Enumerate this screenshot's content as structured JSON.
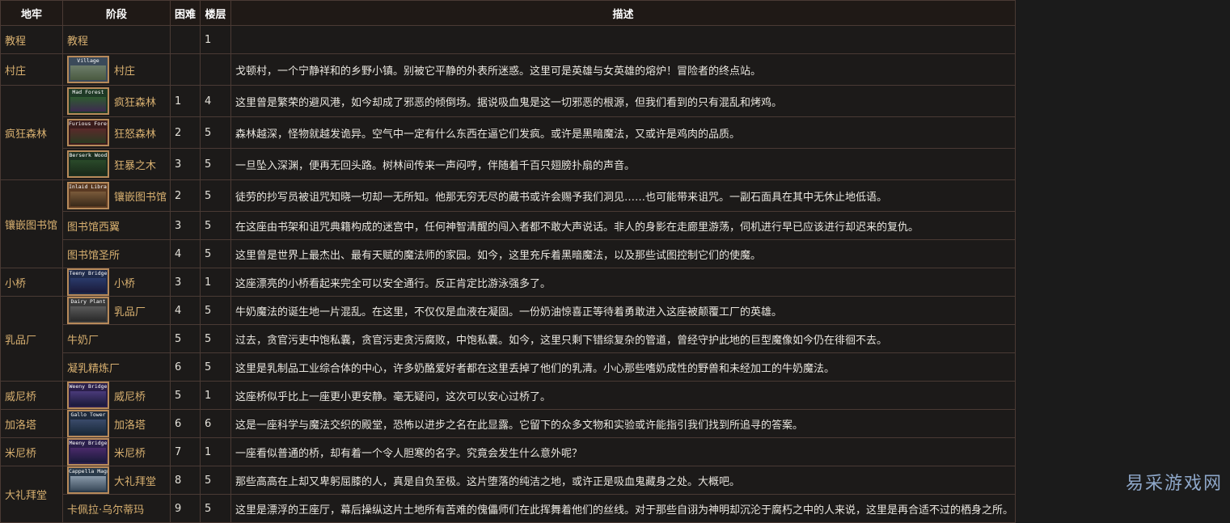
{
  "headers": {
    "dungeon": "地牢",
    "stage": "阶段",
    "difficulty": "困难",
    "floors": "楼层",
    "description": "描述"
  },
  "rows": {
    "tutorial": {
      "dungeon": "教程",
      "stage": "教程",
      "difficulty": "",
      "floors": "1",
      "desc": ""
    },
    "village": {
      "dungeon": "村庄",
      "thumb": "Village",
      "stage": "村庄",
      "difficulty": "",
      "floors": "",
      "desc": "戈顿村，一个宁静祥和的乡野小镇。别被它平静的外表所迷惑。这里可是英雄与女英雄的熔炉！冒险者的终点站。"
    },
    "mad_forest": {
      "dungeon": "疯狂森林",
      "thumb": "Mad Forest",
      "stage": "疯狂森林",
      "difficulty": "1",
      "floors": "4",
      "desc": "这里曾是繁荣的避风港，如今却成了邪恶的倾倒场。据说吸血鬼是这一切邪恶的根源，但我们看到的只有混乱和烤鸡。"
    },
    "furious_forest": {
      "thumb": "Furious Forest",
      "stage": "狂怒森林",
      "difficulty": "2",
      "floors": "5",
      "desc": "森林越深，怪物就越发诡异。空气中一定有什么东西在逼它们发疯。或许是黑暗魔法，又或许是鸡肉的品质。"
    },
    "berserk_wood": {
      "thumb": "Berserk Wood",
      "stage": "狂暴之木",
      "difficulty": "3",
      "floors": "5",
      "desc": "一旦坠入深渊，便再无回头路。树林间传来一声闷哼，伴随着千百只翅膀扑扇的声音。"
    },
    "inlaid_library": {
      "dungeon": "镶嵌图书馆",
      "thumb": "Inlaid Library",
      "stage": "镶嵌图书馆",
      "difficulty": "2",
      "floors": "5",
      "desc": "徒劳的抄写员被诅咒知晓一切却一无所知。他那无穷无尽的藏书或许会赐予我们洞见……也可能带来诅咒。一副石面具在其中无休止地低语。"
    },
    "library_west": {
      "stage": "图书馆西翼",
      "difficulty": "3",
      "floors": "5",
      "desc": "在这座由书架和诅咒典籍构成的迷宫中，任何神智清醒的闯入者都不敢大声说话。非人的身影在走廊里游荡，伺机进行早已应该进行却迟来的复仇。"
    },
    "library_sanctum": {
      "stage": "图书馆圣所",
      "difficulty": "4",
      "floors": "5",
      "desc": "这里曾是世界上最杰出、最有天赋的魔法师的家园。如今，这里充斥着黑暗魔法，以及那些试图控制它们的使魔。"
    },
    "small_bridge": {
      "dungeon": "小桥",
      "thumb": "Teeny Bridge",
      "stage": "小桥",
      "difficulty": "3",
      "floors": "1",
      "desc": "这座漂亮的小桥看起来完全可以安全通行。反正肯定比游泳强多了。"
    },
    "dairy_plant": {
      "dungeon": "乳品厂",
      "thumb": "Dairy Plant",
      "stage": "乳品厂",
      "difficulty": "4",
      "floors": "5",
      "desc": "牛奶魔法的诞生地一片混乱。在这里，不仅仅是血液在凝固。一份奶油惊喜正等待着勇敢进入这座被颠覆工厂的英雄。"
    },
    "cow_factory": {
      "stage": "牛奶厂",
      "difficulty": "5",
      "floors": "5",
      "desc": "过去，贪官污吏中饱私囊，贪官污吏贪污腐败，中饱私囊。如今，这里只剩下错综复杂的管道，曾经守护此地的巨型魔像如今仍在徘徊不去。"
    },
    "curd_refinery": {
      "stage": "凝乳精炼厂",
      "difficulty": "6",
      "floors": "5",
      "desc": "这里是乳制品工业综合体的中心，许多奶酪爱好者都在这里丢掉了他们的乳清。小心那些嗜奶成性的野兽和未经加工的牛奶魔法。"
    },
    "weeny_bridge": {
      "dungeon": "威尼桥",
      "thumb": "Weeny Bridge",
      "stage": "威尼桥",
      "difficulty": "5",
      "floors": "1",
      "desc": "这座桥似乎比上一座更小更安静。毫无疑问，这次可以安心过桥了。"
    },
    "gallo_tower": {
      "dungeon": "加洛塔",
      "thumb": "Gallo Tower",
      "stage": "加洛塔",
      "difficulty": "6",
      "floors": "6",
      "desc": "这是一座科学与魔法交织的殿堂，恐怖以进步之名在此显露。它留下的众多文物和实验或许能指引我们找到所追寻的答案。"
    },
    "meeny_bridge": {
      "dungeon": "米尼桥",
      "thumb": "Meeny Bridge",
      "stage": "米尼桥",
      "difficulty": "7",
      "floors": "1",
      "desc": "一座看似普通的桥，却有着一个令人胆寒的名字。究竟会发生什么意外呢？"
    },
    "cappella": {
      "dungeon": "大礼拜堂",
      "thumb": "Cappella Magna",
      "stage": "大礼拜堂",
      "difficulty": "8",
      "floors": "5",
      "desc": "那些高高在上却又卑躬屈膝的人，真是自负至极。这片堕落的纯洁之地，或许正是吸血鬼藏身之处。大概吧。"
    },
    "carlo": {
      "stage": "卡佩拉·乌尔蒂玛",
      "difficulty": "9",
      "floors": "5",
      "desc": "这里是漂浮的王座厅，幕后操纵这片土地所有苦难的傀儡师们在此挥舞着他们的丝线。对于那些自诩为神明却沉沦于腐朽之中的人来说，这里是再合适不过的栖身之所。"
    }
  },
  "colors": {
    "header_bg": "#1f1916",
    "border": "#4a3a34",
    "label_gold": "#d8b070",
    "text": "#e3e0d8"
  },
  "watermark": "易采游戏网"
}
